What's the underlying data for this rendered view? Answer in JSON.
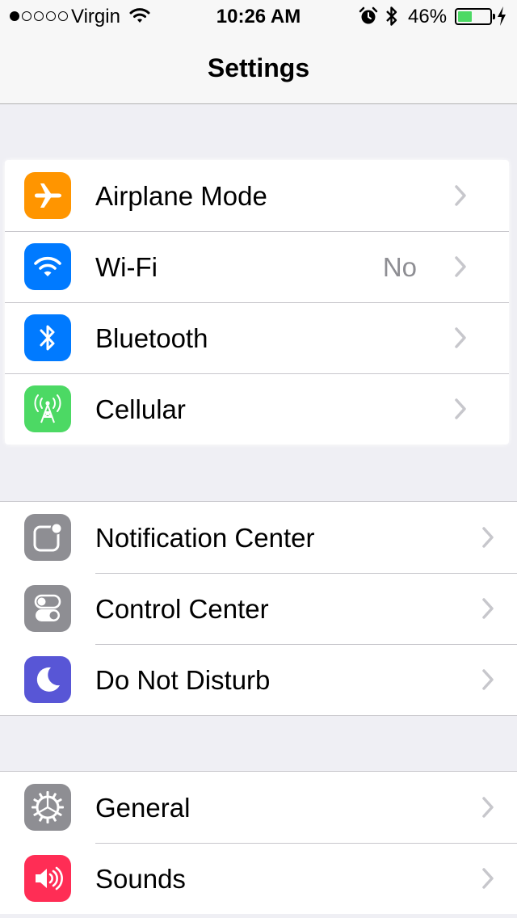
{
  "status_bar": {
    "signal_bars": [
      true,
      false,
      false,
      false,
      false
    ],
    "carrier": "Virgin",
    "time": "10:26 AM",
    "battery_percent": "46%",
    "battery_level": 0.46,
    "icons": [
      "wifi-icon",
      "alarm-icon",
      "bluetooth-icon",
      "battery-icon",
      "charging-icon"
    ]
  },
  "nav": {
    "title": "Settings"
  },
  "groups": [
    {
      "items": [
        {
          "label": "Airplane Mode",
          "icon": "airplane-icon",
          "color": "#ff9500",
          "detail": ""
        },
        {
          "label": "Wi-Fi",
          "icon": "wifi-icon",
          "color": "#007aff",
          "detail": "No"
        },
        {
          "label": "Bluetooth",
          "icon": "bluetooth-icon",
          "color": "#007aff",
          "detail": ""
        },
        {
          "label": "Cellular",
          "icon": "cellular-icon",
          "color": "#4cd964",
          "detail": ""
        }
      ]
    },
    {
      "items": [
        {
          "label": "Notification Center",
          "icon": "notification-center-icon",
          "color": "#8e8e93"
        },
        {
          "label": "Control Center",
          "icon": "control-center-icon",
          "color": "#8e8e93"
        },
        {
          "label": "Do Not Disturb",
          "icon": "moon-icon",
          "color": "#5856d6"
        }
      ]
    },
    {
      "items": [
        {
          "label": "General",
          "icon": "gear-icon",
          "color": "#8e8e93"
        },
        {
          "label": "Sounds",
          "icon": "speaker-icon",
          "color": "#ff2d55"
        }
      ]
    }
  ],
  "colors": {
    "background": "#efeff4",
    "separator": "#c8c7cc",
    "chevron": "#c7c7cc",
    "detail_text": "#8e8e93"
  }
}
